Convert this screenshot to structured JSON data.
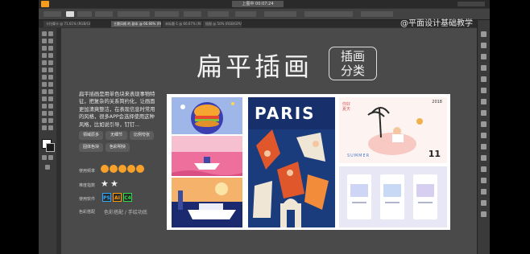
{
  "window": {
    "file_label": "上图中 00:07:24"
  },
  "watermark": "@平面设计基础教学",
  "tabs": [
    {
      "label": "卡拉摩卡 @ 71.61% (RGB/GPU 预览)"
    },
    {
      "label": "主题风格 的 副本 @ 66.66% (RGB/GPU 预览)"
    },
    {
      "label": "未标题-1 @ 66.67% (RGB/GPU 预览)"
    },
    {
      "label": "插图 @ 50% (RGB/GPU 预览)"
    }
  ],
  "slide": {
    "title": "扁平插画",
    "badge_line1": "插画",
    "badge_line2": "分类",
    "description": "扁平插画是用单色块来表现事物特征，把复杂的关系简约化，让画面更加清爽整洁，在表现信息时常用的风格，很多APP会选择使用这种风格，比如说引导，钉钉...",
    "tags": [
      "领域原多",
      "无细节",
      "比例夸张",
      "固体色块",
      "色彩明快"
    ],
    "rows": [
      {
        "label": "使用频率"
      },
      {
        "label": "难度指数"
      },
      {
        "label": "使用软件"
      },
      {
        "label": "色彩搭配"
      }
    ],
    "difficulty": {
      "filled": 2,
      "total": 5
    },
    "software": [
      {
        "name": "PS",
        "color": "#31a8ff"
      },
      {
        "name": "AI",
        "color": "#ff9a00"
      },
      {
        "name": "C4",
        "color": "#2bdc4a"
      }
    ],
    "color_line": "色彩搭配 / 手绘功底"
  },
  "illustrations": {
    "paris_text": "PARIS",
    "summer_text": "SUMMER",
    "year_text": "2018",
    "number_text": "11",
    "corner_text": "你好\n夏天"
  },
  "colors": {
    "bg": "#323232",
    "accent": "#f79c1b",
    "paris_blue": "#17306b",
    "paris_orange": "#e0572b"
  }
}
